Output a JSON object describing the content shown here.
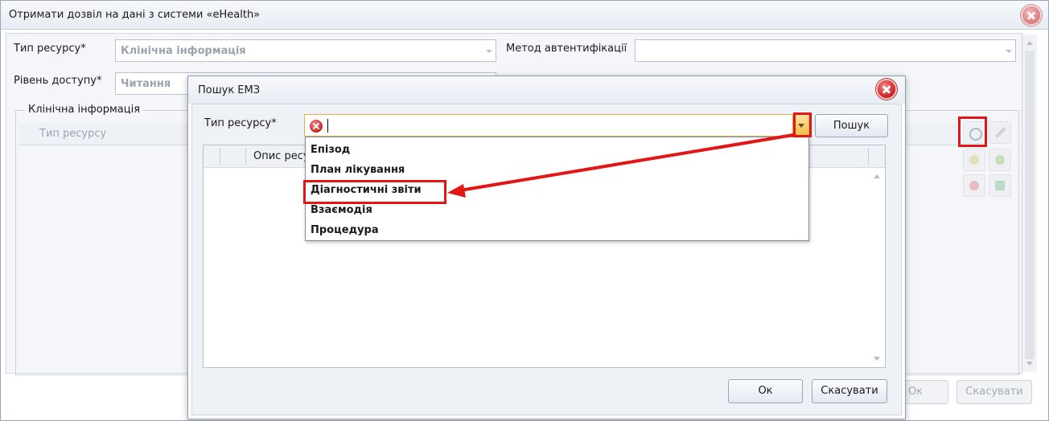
{
  "outer_window": {
    "title": "Отримати дозвіл на дані з системи «eHealth»",
    "resource_type_label": "Тип ресурсу*",
    "resource_type_value": "Клінічна інформація",
    "auth_method_label": "Метод автентифікації",
    "auth_method_value": "",
    "access_level_label": "Рівень доступу*",
    "access_level_value": "Читання",
    "group_title": "Клінічна інформація",
    "grid_column": "Тип ресурсу",
    "ok_label": "Ок",
    "cancel_label": "Скасувати",
    "toolbar_icons": [
      "search-icon",
      "wrench-icon",
      "edit-icon",
      "add-icon",
      "delete-icon",
      "flag-icon"
    ]
  },
  "modal": {
    "title": "Пошук ЕМЗ",
    "resource_type_label": "Тип ресурсу*",
    "resource_type_value": "",
    "search_button": "Пошук",
    "grid_column": "Опис ресурсу",
    "ok_label": "Ок",
    "cancel_label": "Скасувати",
    "dropdown_options": [
      "Епізод",
      "План лікування",
      "Діагностичні звіти",
      "Взаємодія",
      "Процедура"
    ],
    "highlighted_option": "Діагностичні звіти"
  },
  "colors": {
    "annotation": "#e31515",
    "dropdown_button": "#f5b940",
    "close_button": "#d42a2a"
  }
}
